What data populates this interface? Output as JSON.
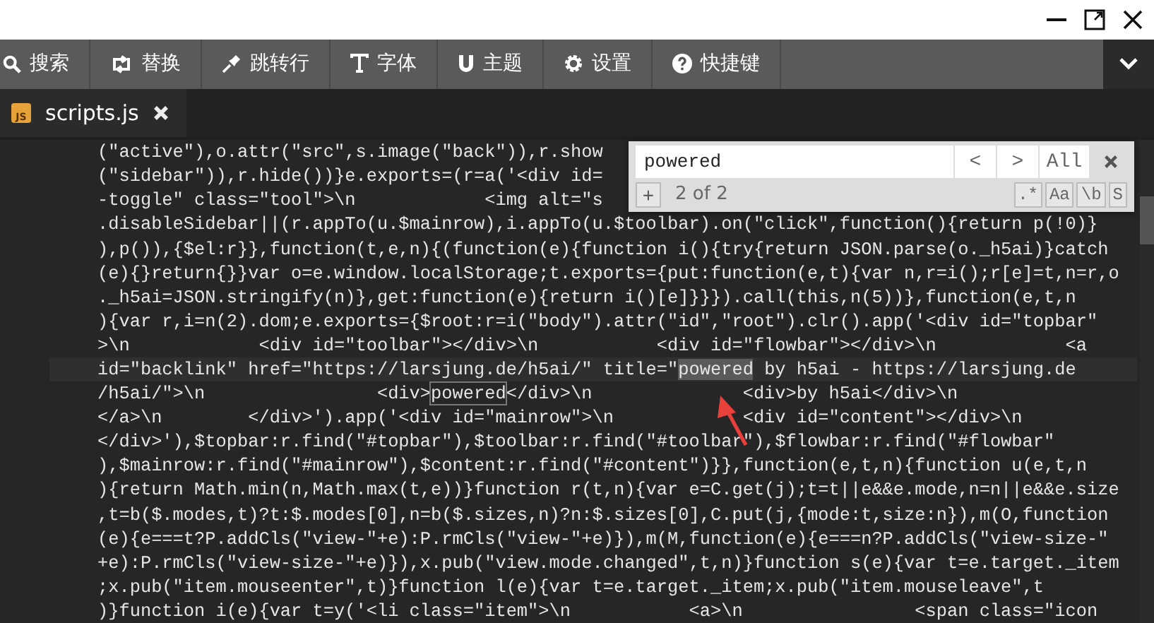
{
  "toolbar": {
    "items": [
      {
        "label": "搜索"
      },
      {
        "label": "替换"
      },
      {
        "label": "跳转行"
      },
      {
        "label": "字体"
      },
      {
        "label": "主题"
      },
      {
        "label": "设置"
      },
      {
        "label": "快捷键"
      }
    ]
  },
  "tabs": [
    {
      "label": "scripts.js",
      "file_icon_text": "JS",
      "selected": true
    }
  ],
  "code_lines": [
    {
      "current": false,
      "parts": [
        {
          "kind": "plain",
          "text": "(\"active\"),o.attr(\"src\",s.image(\"back\")),r.show"
        }
      ]
    },
    {
      "current": false,
      "parts": [
        {
          "kind": "plain",
          "text": "(\"sidebar\")),r.hide())}e.exports=(r=a('<div id="
        }
      ]
    },
    {
      "current": false,
      "parts": [
        {
          "kind": "plain",
          "text": "-toggle\" class=\"tool\">\\n            <img alt=\"s"
        }
      ]
    },
    {
      "current": false,
      "parts": [
        {
          "kind": "plain",
          "text": ".disableSidebar||(r.appTo(u.$mainrow),i.appTo(u.$toolbar).on(\"click\",function(){return p(!0)}"
        }
      ]
    },
    {
      "current": false,
      "parts": [
        {
          "kind": "plain",
          "text": "),p()),{$el:r}},function(t,e,n){(function(e){function i(){try{return JSON.parse(o._h5ai)}catch"
        }
      ]
    },
    {
      "current": false,
      "parts": [
        {
          "kind": "plain",
          "text": "(e){}return{}}var o=e.window.localStorage;t.exports={put:function(e,t){var n,r=i();r[e]=t,n=r,o"
        }
      ]
    },
    {
      "current": false,
      "parts": [
        {
          "kind": "plain",
          "text": "._h5ai=JSON.stringify(n)},get:function(e){return i()[e]}}}).call(this,n(5))},function(e,t,n"
        }
      ]
    },
    {
      "current": false,
      "parts": [
        {
          "kind": "plain",
          "text": "){var r,i=n(2).dom;e.exports={$root:r=i(\"body\").attr(\"id\",\"root\").clr().app('<div id=\"topbar\""
        }
      ]
    },
    {
      "current": false,
      "parts": [
        {
          "kind": "plain",
          "text": ">\\n            <div id=\"toolbar\"></div>\\n           <div id=\"flowbar\"></div>\\n            <a"
        }
      ]
    },
    {
      "current": true,
      "parts": [
        {
          "kind": "plain",
          "text": "id=\"backlink\" href=\"https://larsjung.de/h5ai/\" title=\""
        },
        {
          "kind": "current-match",
          "text": "powered"
        },
        {
          "kind": "plain",
          "text": " by h5ai - https://larsjung.de"
        }
      ]
    },
    {
      "current": false,
      "parts": [
        {
          "kind": "plain",
          "text": "/h5ai/\">\\n                <div>"
        },
        {
          "kind": "match",
          "text": "powered"
        },
        {
          "kind": "plain",
          "text": "</div>\\n              <div>by h5ai</div>\\n"
        }
      ]
    },
    {
      "current": false,
      "parts": [
        {
          "kind": "plain",
          "text": "</a>\\n        </div>').app('<div id=\"mainrow\">\\n            <div id=\"content\"></div>\\n"
        }
      ]
    },
    {
      "current": false,
      "parts": [
        {
          "kind": "plain",
          "text": "</div>'),$topbar:r.find(\"#topbar\"),$toolbar:r.find(\"#toolbar\"),$flowbar:r.find(\"#flowbar\""
        }
      ]
    },
    {
      "current": false,
      "parts": [
        {
          "kind": "plain",
          "text": "),$mainrow:r.find(\"#mainrow\"),$content:r.find(\"#content\")}},function(e,t,n){function u(e,t,n"
        }
      ]
    },
    {
      "current": false,
      "parts": [
        {
          "kind": "plain",
          "text": "){return Math.min(n,Math.max(t,e))}function r(t,n){var e=C.get(j);t=t||e&&e.mode,n=n||e&&e.size"
        }
      ]
    },
    {
      "current": false,
      "parts": [
        {
          "kind": "plain",
          "text": ",t=b($.modes,t)?t:$.modes[0],n=b($.sizes,n)?n:$.sizes[0],C.put(j,{mode:t,size:n}),m(O,function"
        }
      ]
    },
    {
      "current": false,
      "parts": [
        {
          "kind": "plain",
          "text": "(e){e===t?P.addCls(\"view-\"+e):P.rmCls(\"view-\"+e)}),m(M,function(e){e===n?P.addCls(\"view-size-\""
        }
      ]
    },
    {
      "current": false,
      "parts": [
        {
          "kind": "plain",
          "text": "+e):P.rmCls(\"view-size-\"+e)}),x.pub(\"view.mode.changed\",t,n)}function s(e){var t=e.target._item"
        }
      ]
    },
    {
      "current": false,
      "parts": [
        {
          "kind": "plain",
          "text": ";x.pub(\"item.mouseenter\",t)}function l(e){var t=e.target._item;x.pub(\"item.mouseleave\",t"
        }
      ]
    },
    {
      "current": false,
      "parts": [
        {
          "kind": "plain",
          "text": ")}function i(e){var t=y('<li class=\"item\">\\n           <a>\\n                <span class=\"icon"
        }
      ]
    }
  ],
  "search": {
    "value": "powered",
    "prev": "<",
    "next": ">",
    "all": "All",
    "add": "+",
    "count": "2 of 2",
    "options": [
      {
        "label": ".*",
        "on": false
      },
      {
        "label": "Aa",
        "on": false
      },
      {
        "label": "\\b",
        "on": false
      },
      {
        "label": "S",
        "on": false
      }
    ]
  }
}
